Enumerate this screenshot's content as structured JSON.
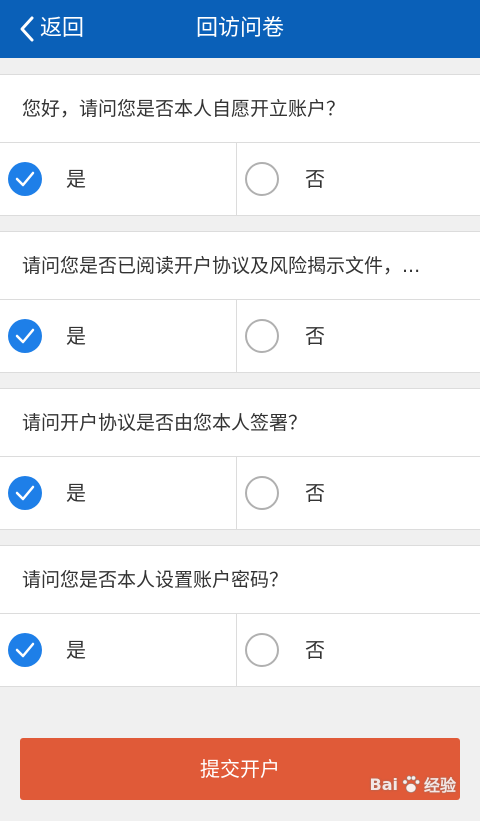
{
  "header": {
    "back_label": "返回",
    "title": "回访问卷",
    "background": "#0a60b8"
  },
  "questions": [
    {
      "text": "您好，请问您是否本人自愿开立账户？",
      "yes_label": "是",
      "no_label": "否",
      "selected": "yes"
    },
    {
      "text": "请问您是否已阅读开户协议及风险揭示文件，...",
      "yes_label": "是",
      "no_label": "否",
      "selected": "yes"
    },
    {
      "text": "请问开户协议是否由您本人签署？",
      "yes_label": "是",
      "no_label": "否",
      "selected": "yes"
    },
    {
      "text": "请问您是否本人设置账户密码？",
      "yes_label": "是",
      "no_label": "否",
      "selected": "yes"
    }
  ],
  "submit": {
    "label": "提交开户",
    "color": "#e05a38"
  },
  "watermark": {
    "text_left": "Bai",
    "text_right": "经验"
  },
  "colors": {
    "accent": "#1e7fe8"
  },
  "icons": {
    "back": "chevron-left-icon",
    "checked": "checkmark-icon",
    "watermark": "paw-icon"
  }
}
